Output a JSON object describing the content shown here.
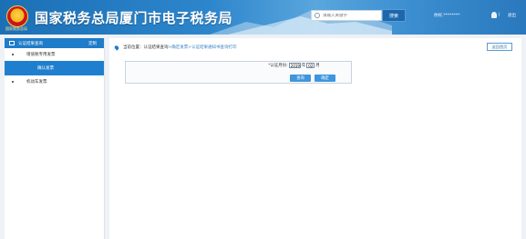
{
  "header": {
    "emblem_label": "国家税务总局",
    "title": "国家税务总局厦门市电子税务局",
    "search_placeholder": "请输入关键字",
    "search_button": "搜索",
    "user_text": "你好,********",
    "separator": "|",
    "logout": "退出",
    "brand_color": "#1b6fb5"
  },
  "sidebar": {
    "header_label": "认证结果查询",
    "header_tag": "定制",
    "items": [
      {
        "label": "增值税专用发票"
      },
      {
        "label": "确认发票",
        "active": true
      },
      {
        "label": "机动车发票"
      }
    ]
  },
  "main": {
    "breadcrumb": {
      "prefix": "当前位置：",
      "trail_1": "认证结果查询",
      "trail_sep": " > ",
      "trail_2": "确定发票",
      "trail_3": "认证结果通知书查询打印"
    },
    "back_button": "返回首页",
    "query": {
      "required_mark": "*",
      "label": "认证月份:",
      "year_value": "2019",
      "year_unit": "年",
      "month_value": "02",
      "month_unit": "月"
    },
    "buttons": {
      "query": "查询",
      "confirm": "确定"
    }
  }
}
